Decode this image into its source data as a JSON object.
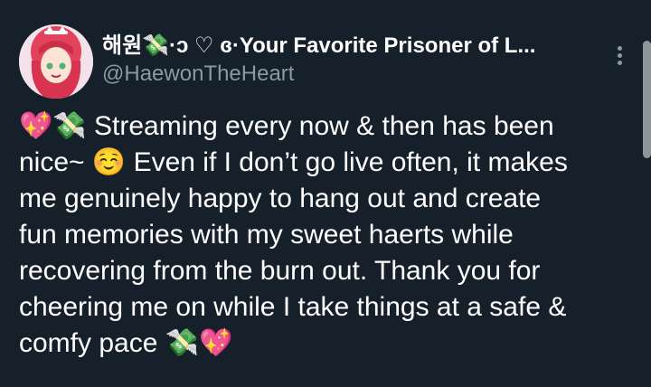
{
  "tweet": {
    "display_name": "해원💸·ↄ ♡ ɞ·Your Favorite Prisoner of L...",
    "handle": "@HaewonTheHeart",
    "body_lines": [
      "💖💸 Streaming every now & then has been",
      "nice~ ☺️ Even if I don’t go live often, it makes",
      "me genuinely happy to hang out and create",
      "fun memories with my sweet haerts while",
      "recovering from the burn out. Thank you for",
      "cheering me on while I take things at a safe &",
      "comfy pace 💸💖"
    ],
    "emoji_names": [
      "sparkling-heart-icon",
      "money-with-wings-icon",
      "smiling-face-icon"
    ]
  },
  "colors": {
    "background": "#15202b",
    "text": "#ffffff",
    "secondary_text": "#8b98a5"
  }
}
